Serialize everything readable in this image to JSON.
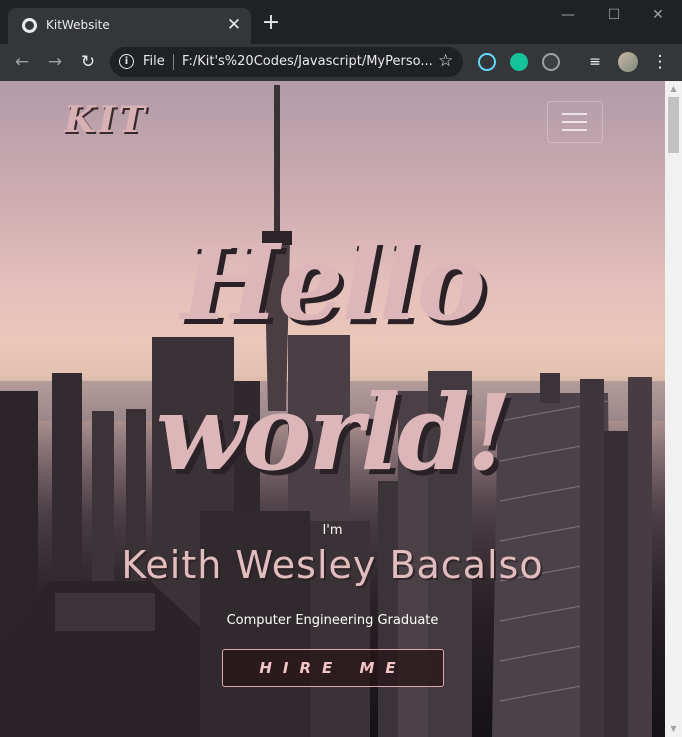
{
  "browser": {
    "tab_title": "KitWebsite",
    "tab_close": "✕",
    "new_tab": "+",
    "window_minimize": "—",
    "window_maximize": "☐",
    "window_close": "✕",
    "nav_back": "←",
    "nav_forward": "→",
    "nav_reload": "↻",
    "omnibox_info": "i",
    "omnibox_scheme": "File",
    "omnibox_url": "F:/Kit's%20Codes/Javascript/MyPerso...",
    "bookmark_star": "☆",
    "menu_dots": "⋮"
  },
  "site": {
    "logo": "KIT",
    "hero_line1": "Hello",
    "hero_line2": "world!",
    "intro": "I'm",
    "name": "Keith Wesley Bacalso",
    "subtitle": "Computer Engineering Graduate",
    "cta": "HIRE ME"
  },
  "colors": {
    "accent_pink": "#ddb6b9",
    "browser_dark": "#202124",
    "toolbar": "#35363a"
  }
}
